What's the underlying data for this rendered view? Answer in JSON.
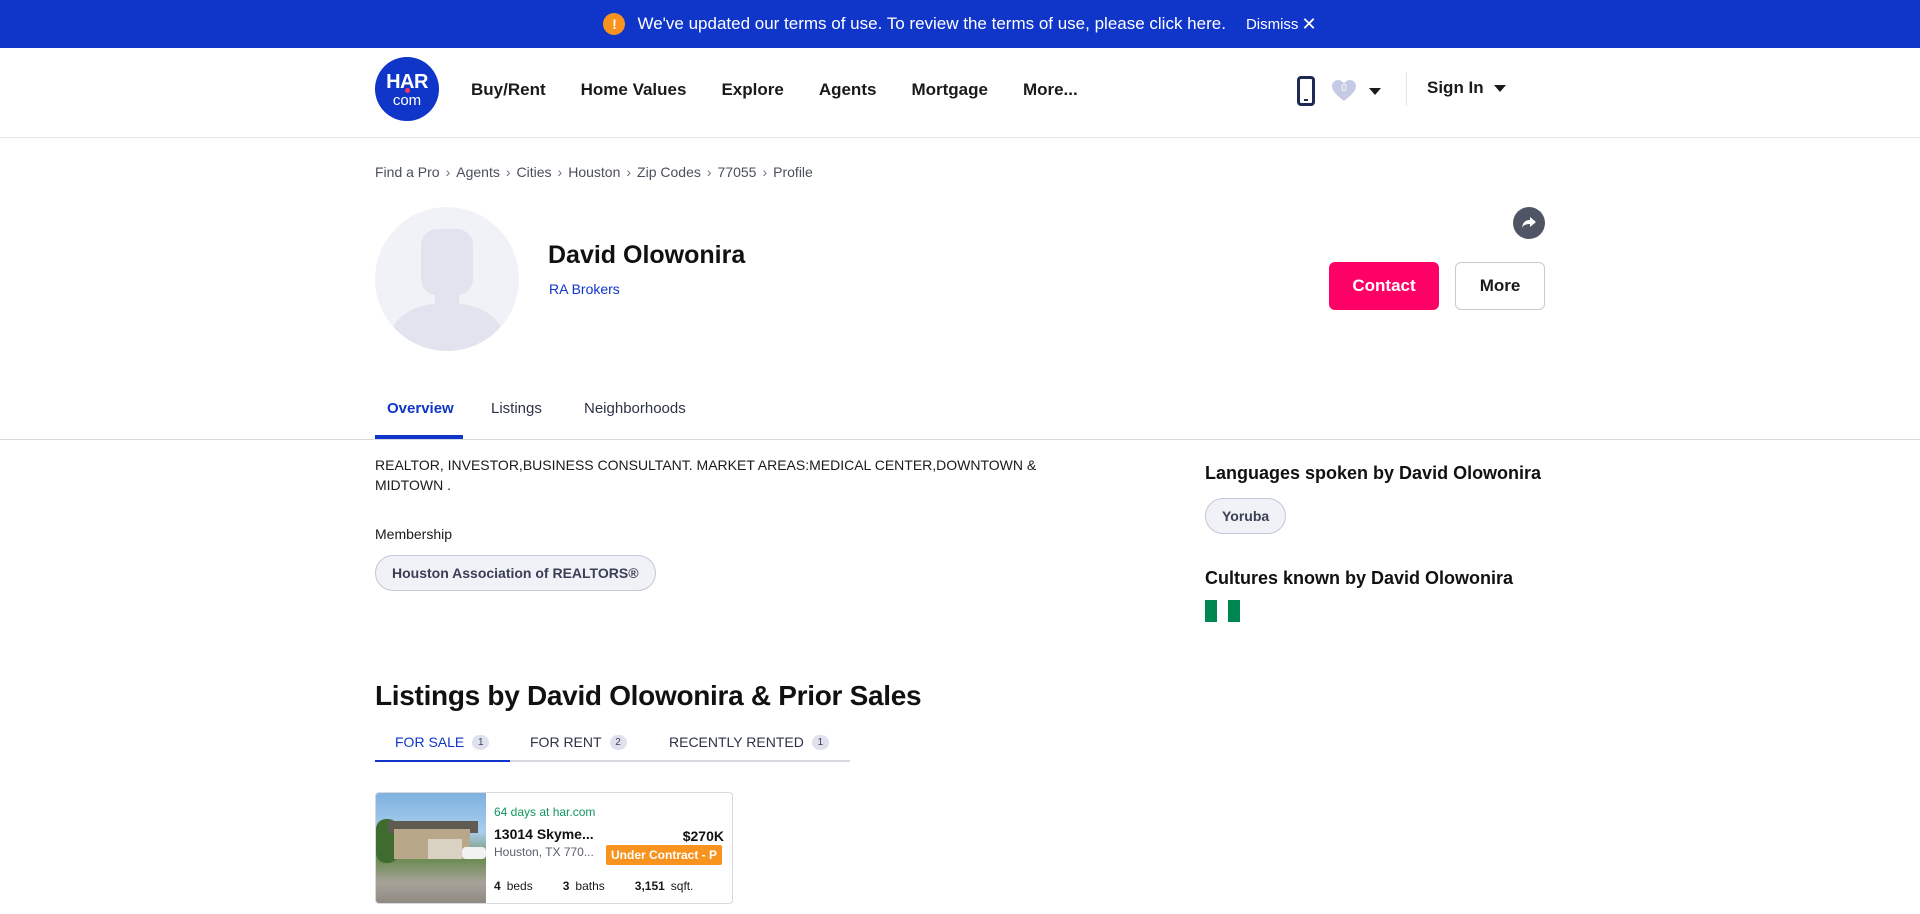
{
  "banner": {
    "message": "We've updated our terms of use. To review the terms of use, please click here.",
    "dismiss_label": "Dismiss",
    "warn_glyph": "!"
  },
  "header": {
    "logo": {
      "line1": "HAR",
      "line2": "com"
    },
    "nav": [
      "Buy/Rent",
      "Home Values",
      "Explore",
      "Agents",
      "Mortgage",
      "More..."
    ],
    "favorites_count": "0",
    "signin_label": "Sign In"
  },
  "breadcrumb": [
    "Find a Pro",
    "Agents",
    "Cities",
    "Houston",
    "Zip Codes",
    "77055",
    "Profile"
  ],
  "profile": {
    "name": "David Olowonira",
    "broker": "RA Brokers",
    "contact_label": "Contact",
    "more_label": "More"
  },
  "tabs": [
    "Overview",
    "Listings",
    "Neighborhoods"
  ],
  "overview": {
    "bio": "REALTOR, INVESTOR,BUSINESS CONSULTANT. MARKET AREAS:MEDICAL CENTER,DOWNTOWN & MIDTOWN .",
    "membership_label": "Membership",
    "membership": "Houston Association of REALTORS®"
  },
  "sidebar": {
    "languages_heading": "Languages spoken by David Olowonira",
    "language": "Yoruba",
    "cultures_heading": "Cultures known by David Olowonira",
    "flag_colors": [
      "#008751",
      "#ffffff",
      "#008751"
    ]
  },
  "listings": {
    "heading": "Listings by David Olowonira & Prior Sales",
    "tabs": [
      {
        "label": "FOR SALE",
        "count": "1"
      },
      {
        "label": "FOR RENT",
        "count": "2"
      },
      {
        "label": "RECENTLY RENTED",
        "count": "1"
      }
    ],
    "card": {
      "days": "64 days at har.com",
      "address": "13014 Skyme...",
      "city": "Houston, TX 770...",
      "price": "$270K",
      "status": "Under Contract - P",
      "beds": "4",
      "beds_label": "beds",
      "baths": "3",
      "baths_label": "baths",
      "sqft": "3,151",
      "sqft_label": "sqft."
    }
  },
  "colors": {
    "brand_blue": "#0f35c9",
    "contact_pink": "#ff0066",
    "status_orange": "#f7931e",
    "days_green": "#12965a"
  }
}
